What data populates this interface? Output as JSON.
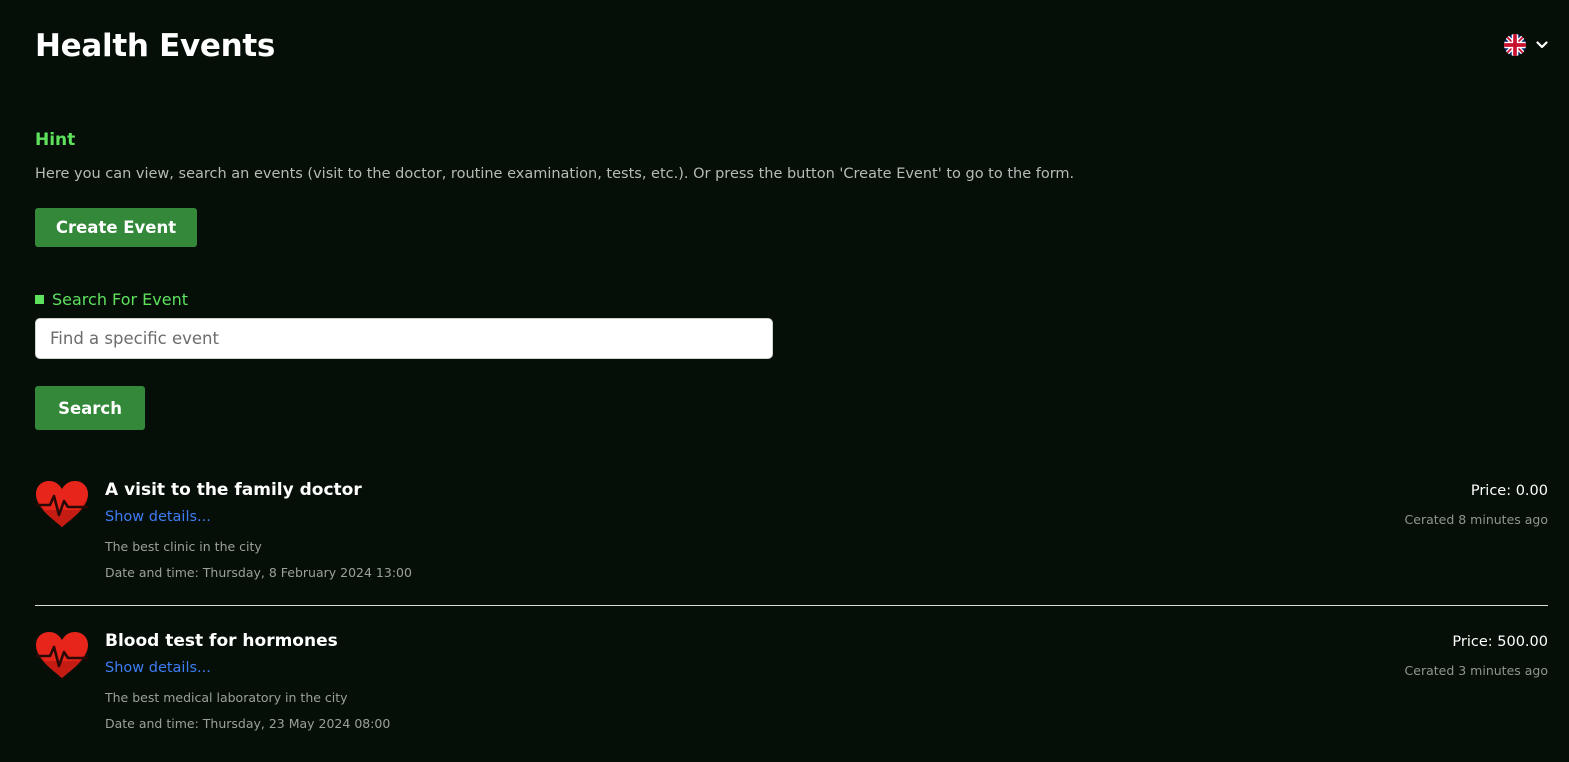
{
  "header": {
    "title": "Health Events",
    "language_icon": "uk-flag-icon",
    "dropdown_icon": "chevron-down-icon"
  },
  "hint": {
    "title": "Hint",
    "text": "Here you can view, search an events (visit to the doctor, routine examination, tests, etc.). Or press the button 'Create Event' to go to the form."
  },
  "create_button": "Create Event",
  "search": {
    "label": "Search For Event",
    "placeholder": "Find a specific event",
    "button": "Search"
  },
  "events": [
    {
      "title": "A visit to the family doctor",
      "details_link": "Show details...",
      "place": "The best clinic in the city",
      "datetime": "Date and time: Thursday, 8 February 2024 13:00",
      "price": "Price: 0.00",
      "created": "Cerated 8 minutes ago",
      "icon": "heart-pulse-icon"
    },
    {
      "title": "Blood test for hormones",
      "details_link": "Show details...",
      "place": "The best medical laboratory in the city",
      "datetime": "Date and time: Thursday, 23 May 2024 08:00",
      "price": "Price: 500.00",
      "created": "Cerated 3 minutes ago",
      "icon": "heart-pulse-icon"
    }
  ],
  "colors": {
    "background": "#050f07",
    "accent": "#5ee25e",
    "button": "#33883a",
    "link": "#3d7df5",
    "heart": "#e8251a"
  }
}
